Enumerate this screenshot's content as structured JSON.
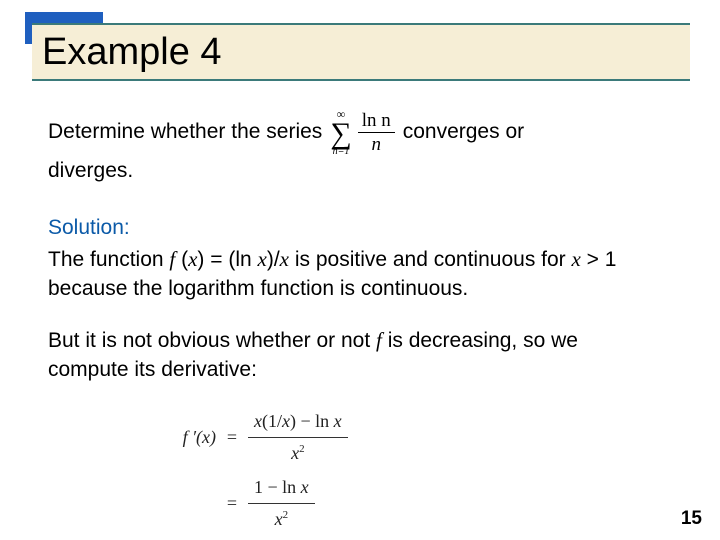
{
  "title": "Example 4",
  "p1_a": "Determine whether the series",
  "p1_b": "converges or",
  "p1_c": "diverges.",
  "sum": {
    "top": "∞",
    "sigma": "∑",
    "bottom": "n=1",
    "num": "ln n",
    "den": "n"
  },
  "solution_label": "Solution:",
  "p2": "The function f (x) = (ln x)/x is positive and continuous for x > 1 because the logarithm function is continuous.",
  "p3": "But it is not obvious whether or not f is decreasing, so we compute its derivative:",
  "deriv": {
    "lhs": "f ′(x)",
    "line1_num": "x(1/x) − ln x",
    "line1_den": "x",
    "line2_num": "1 − ln x",
    "line2_den": "x",
    "sq": "2"
  },
  "page_number": "15"
}
